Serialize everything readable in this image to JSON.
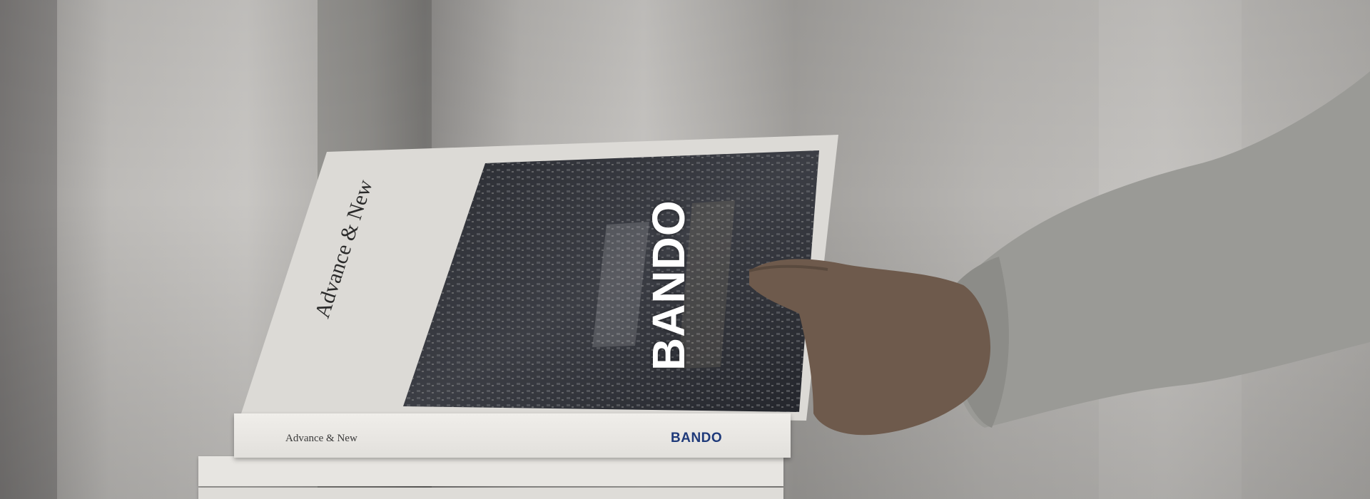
{
  "scene": {
    "description_free": true
  },
  "book": {
    "cover_title": "Advance & New",
    "cover_brand": "BANDO",
    "spine_title": "Advance & New",
    "spine_brand": "BANDO"
  },
  "colors": {
    "brand_blue": "#1f3a7a",
    "cover_white": "#dcdad6",
    "sweater_gray": "#9a9a96"
  }
}
